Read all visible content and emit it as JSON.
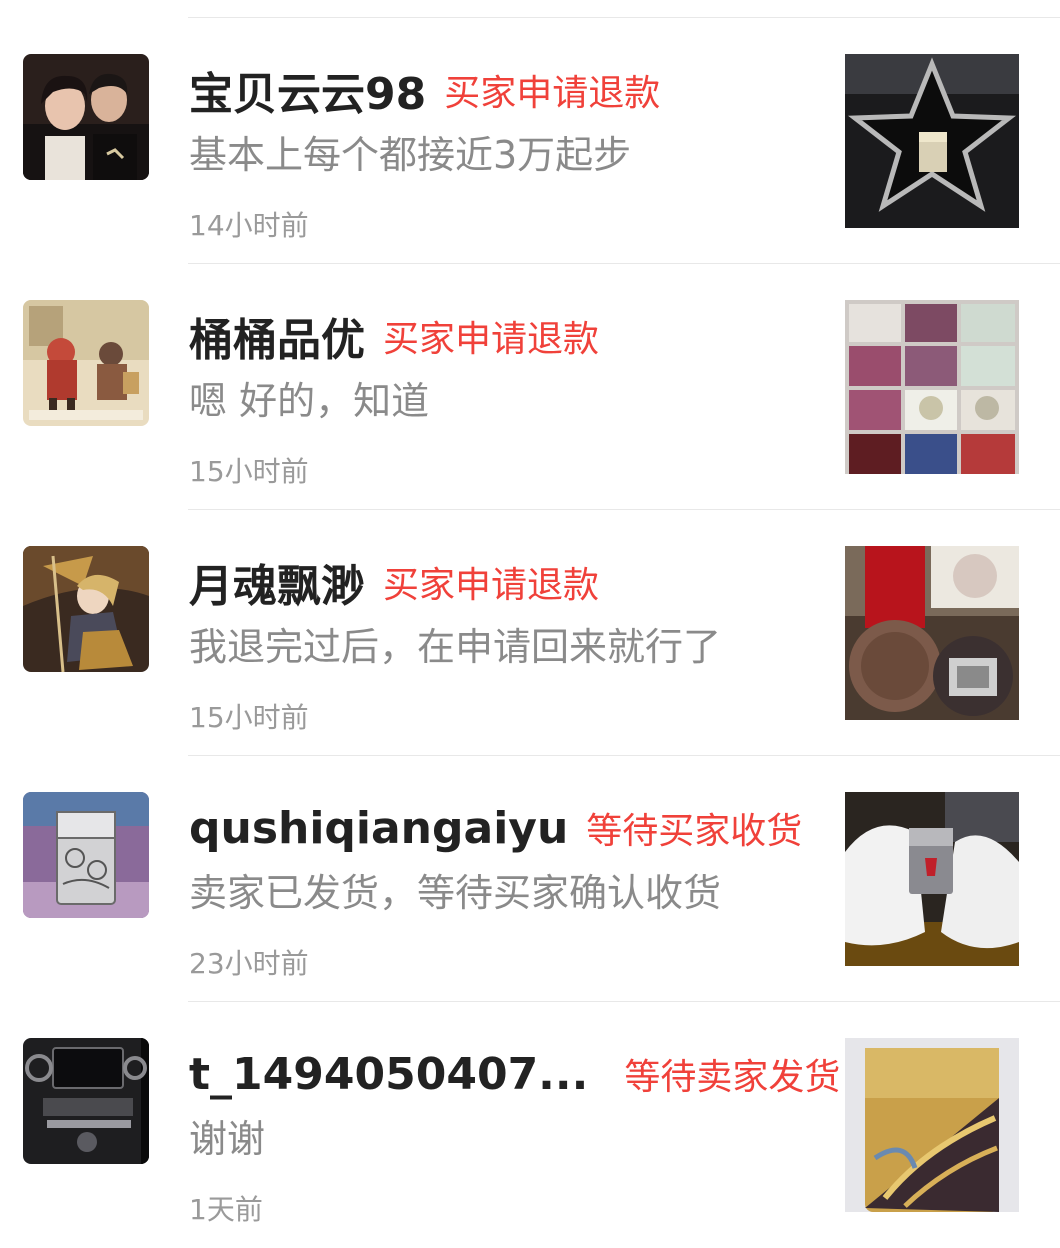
{
  "conversations": [
    {
      "name": "宝贝云云98",
      "status": "买家申请退款",
      "message": "基本上每个都接近3万起步",
      "time": "14小时前",
      "avatar_icon": "couple-photo",
      "thumbnail_icon": "star-tray-lighter"
    },
    {
      "name": "桶桶品优",
      "status": "买家申请退款",
      "message": "嗯 好的，知道",
      "time": "15小时前",
      "avatar_icon": "vintage-poster",
      "thumbnail_icon": "lighter-collection-boxes"
    },
    {
      "name": "月魂飘渺",
      "status": "买家申请退款",
      "message": "我退完过后，在申请回来就行了",
      "time": "15小时前",
      "avatar_icon": "game-character",
      "thumbnail_icon": "lighter-tin-boxes"
    },
    {
      "name": "qushiqiangaiyu",
      "status": "等待买家收货",
      "message": "卖家已发货，等待买家确认收货",
      "time": "23小时前",
      "avatar_icon": "engraved-lighter",
      "thumbnail_icon": "gloved-hands-lighter"
    },
    {
      "name": "t_1494050407...",
      "status": "等待卖家发货",
      "message": "谢谢",
      "time": "1天前",
      "avatar_icon": "car-dashboard",
      "thumbnail_icon": "gold-lighter"
    }
  ],
  "colors": {
    "status_red": "#f0413a",
    "name_text": "#222222",
    "message_text": "#8a8a8a",
    "divider": "#e8e8e8"
  }
}
